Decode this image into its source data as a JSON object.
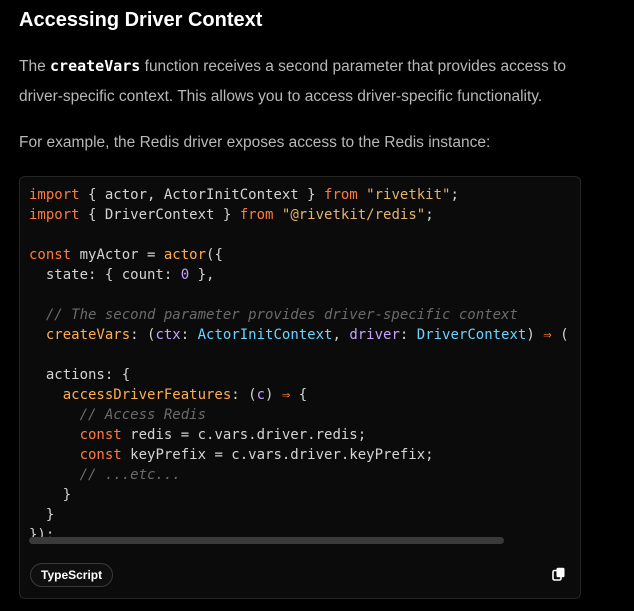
{
  "heading": "Accessing Driver Context",
  "para1": {
    "prefix": "The ",
    "code": "createVars",
    "suffix": " function receives a second parameter that provides access to driver-specific context. This allows you to access driver-specific functionality."
  },
  "para2": "For example, the Redis driver exposes access to the Redis instance:",
  "code_block": {
    "language": "TypeScript",
    "copy_icon": "copy-icon",
    "lines": [
      "import { actor, ActorInitContext } from \"rivetkit\";",
      "import { DriverContext } from \"@rivetkit/redis\";",
      "",
      "const myActor = actor({",
      "  state: { count: 0 },",
      "",
      "  // The second parameter provides driver-specific context",
      "  createVars: (ctx: ActorInitContext, driver: DriverContext) ⇒ (",
      "",
      "  actions: {",
      "    accessDriverFeatures: (c) ⇒ {",
      "      // Access Redis",
      "      const redis = c.vars.driver.redis;",
      "      const keyPrefix = c.vars.driver.keyPrefix;",
      "      // ...etc...",
      "    }",
      "  }",
      "});"
    ]
  }
}
